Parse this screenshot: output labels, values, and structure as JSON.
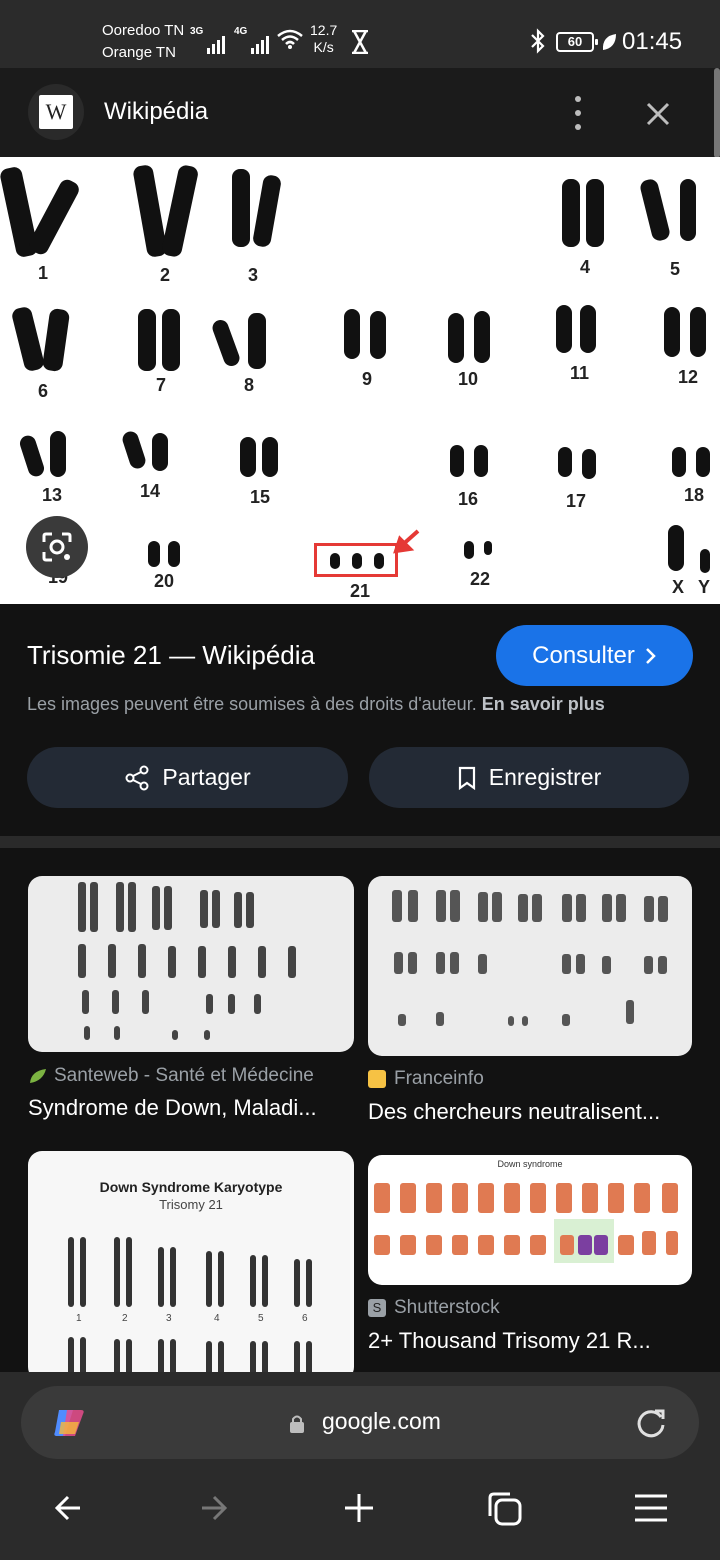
{
  "status_bar": {
    "carrier_1": "Ooredoo TN",
    "carrier_2": "Orange TN",
    "network_1": "3G",
    "network_2": "4G",
    "speed_value": "12.7",
    "speed_unit": "K/s",
    "battery": "60",
    "time": "01:45"
  },
  "header": {
    "logo_letter": "W",
    "title": "Wikipédia"
  },
  "hero_image": {
    "chromosome_labels": [
      "1",
      "2",
      "3",
      "4",
      "5",
      "6",
      "7",
      "8",
      "9",
      "10",
      "11",
      "12",
      "13",
      "14",
      "15",
      "16",
      "17",
      "18",
      "19",
      "20",
      "21",
      "22",
      "X",
      "Y"
    ]
  },
  "result": {
    "title": "Trisomie 21 — Wikipédia",
    "consult_label": "Consulter",
    "copyright_text": "Les images peuvent être soumises à des droits d'auteur.",
    "learn_more": "En savoir plus",
    "share_label": "Partager",
    "save_label": "Enregistrer"
  },
  "related": [
    {
      "source": "Santeweb - Santé et Médecine",
      "caption": "Syndrome de Down, Maladi...",
      "source_color": "#7cb342"
    },
    {
      "source": "Franceinfo",
      "caption": "Des chercheurs neutralisent...",
      "source_color": "#f6c244"
    },
    {
      "source": "",
      "caption": "",
      "image_title": "Down Syndrome Karyotype",
      "image_subtitle": "Trisomy 21",
      "image_labels": [
        "1",
        "2",
        "3",
        "4",
        "5",
        "6"
      ]
    },
    {
      "source": "Shutterstock",
      "caption": "2+ Thousand Trisomy 21 R...",
      "source_color": "#9aa0a6",
      "image_title": "Down syndrome"
    }
  ],
  "browser": {
    "url": "google.com"
  },
  "colors": {
    "accent": "#1a73e8",
    "background": "#121212",
    "pill": "#232a35"
  }
}
